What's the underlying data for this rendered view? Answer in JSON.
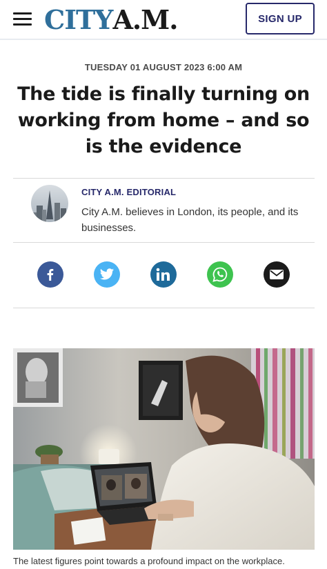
{
  "header": {
    "logo_city": "CITY",
    "logo_am": "A.M.",
    "signup_label": "SIGN UP"
  },
  "article": {
    "dateline": "TUESDAY 01 AUGUST 2023 6:00 AM",
    "headline": "The tide is finally turning on working from home – and so is the evidence",
    "author_name": "CITY A.M. EDITORIAL",
    "author_bio": "City A.M. believes in London, its people, and its businesses.",
    "image_caption": "The latest figures point towards a profound impact on the workplace."
  },
  "share": {
    "items": [
      {
        "icon": "facebook-icon",
        "color": "#3b5998"
      },
      {
        "icon": "twitter-icon",
        "color": "#4ab3f4"
      },
      {
        "icon": "linkedin-icon",
        "color": "#1e6a9a"
      },
      {
        "icon": "whatsapp-icon",
        "color": "#3ec34f"
      },
      {
        "icon": "email-icon",
        "color": "#1b1b1b"
      }
    ]
  },
  "colors": {
    "brand_blue": "#2f6f9b",
    "navy": "#26286a"
  }
}
